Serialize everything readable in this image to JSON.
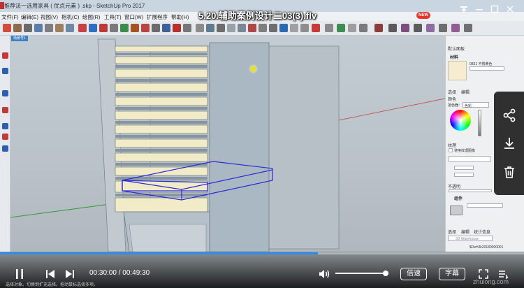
{
  "video": {
    "title": "5.20.辅助案例设计二03(3).flv",
    "current_time": "00:30:00",
    "separator": "/",
    "total_time": "00:49:30",
    "progress": 0.606,
    "volume": 0.98,
    "speed_label": "倍速",
    "new_badge": "NEW",
    "subtitle_label": "字幕",
    "watermark": "zhulong.com",
    "accent": "#2a8de8"
  },
  "sketchup": {
    "window_title": "推荐法一选用家具 ( 优点元素 ) .skp - SketchUp Pro 2017",
    "menu": [
      "文件(F)",
      "编辑(E)",
      "视图(V)",
      "相机(C)",
      "绘图(R)",
      "工具(T)",
      "窗口(W)",
      "扩展程序",
      "帮助(H)"
    ],
    "scene_tab": "场景号1",
    "status_text": "选择对象。切换到扩充选择。拖动鼠标选择多项。",
    "tray": {
      "title": "默认面板",
      "materials_header": "材料",
      "material_name": "0831 不锈黄色",
      "tabs": [
        "选择",
        "编辑"
      ],
      "color_label": "颜色",
      "picker_label": "拾色器：",
      "picker_value": "色轮",
      "texture_label": "纹理",
      "use_texture": "使用纹理图像",
      "opacity_label": "不透明",
      "components_header": "组件",
      "comp_tabs": [
        "选择",
        "编辑",
        "统计信息"
      ],
      "warehouse": "3D Warehouse",
      "comp_items": [
        "$DeHJk20180000001",
        "$DeHJk20180000001"
      ]
    }
  }
}
